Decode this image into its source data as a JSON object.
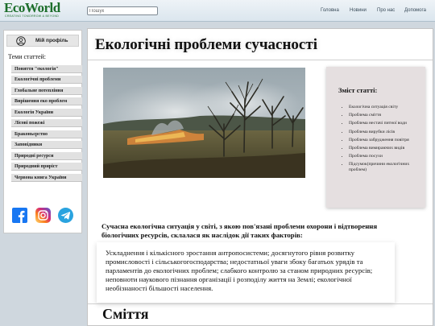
{
  "header": {
    "logo": "EcoWorld",
    "logo_tagline": "CREATING TOMORROW & BEYOND",
    "search_placeholder": "Пошук",
    "nav": [
      "Головна",
      "Новини",
      "Про нас",
      "Допомога"
    ]
  },
  "sidebar": {
    "profile_label": "Мій профіль",
    "themes_title": "Теми статтей:",
    "topics": [
      "Поняття \"екологія\"",
      "Екологічні проблеми",
      "Глобальне потепління",
      "Вирішення еко проблем",
      "Екологія України",
      "Лісові пожежі",
      "Браконьєрство",
      "Заповідники",
      "Природні ресурси",
      "Природний приріст",
      "Червона книга України"
    ],
    "social": [
      "facebook-icon",
      "instagram-icon",
      "telegram-icon"
    ]
  },
  "main": {
    "title": "Екологічні проблеми сучасності",
    "toc_title": "Зміст статті:",
    "toc": [
      "Екологічна ситуація світу",
      "Проблема сміття",
      "Проблема нестачі питної води",
      "Проблема вирубки лісів",
      "Проблема забрудження повітря",
      "Проблема вимираючих видів",
      "Проблема посухи",
      "Підсумок(причини екологічних проблем)"
    ],
    "lead": "Сучасна екологічна ситуація у світі, з якою пов'язані проблеми охорони і відтворення біологічних ресурсів, склалася як наслідок дії таких факторів:",
    "paragraph": "Ускладнення і кількісного зростання антропосистеми; досягнутого рівня розвитку промисловості і сільськогогосподарства; недостатньої уваги збоку багатьох урядів та парламентів до екологічних проблем; слабкого контролю за станом природних ресурсів; неповноти наукового пізнання організації і розподілу життя на Землі; екологічної необізнаності більшості населення.",
    "section_title": "Сміття"
  }
}
